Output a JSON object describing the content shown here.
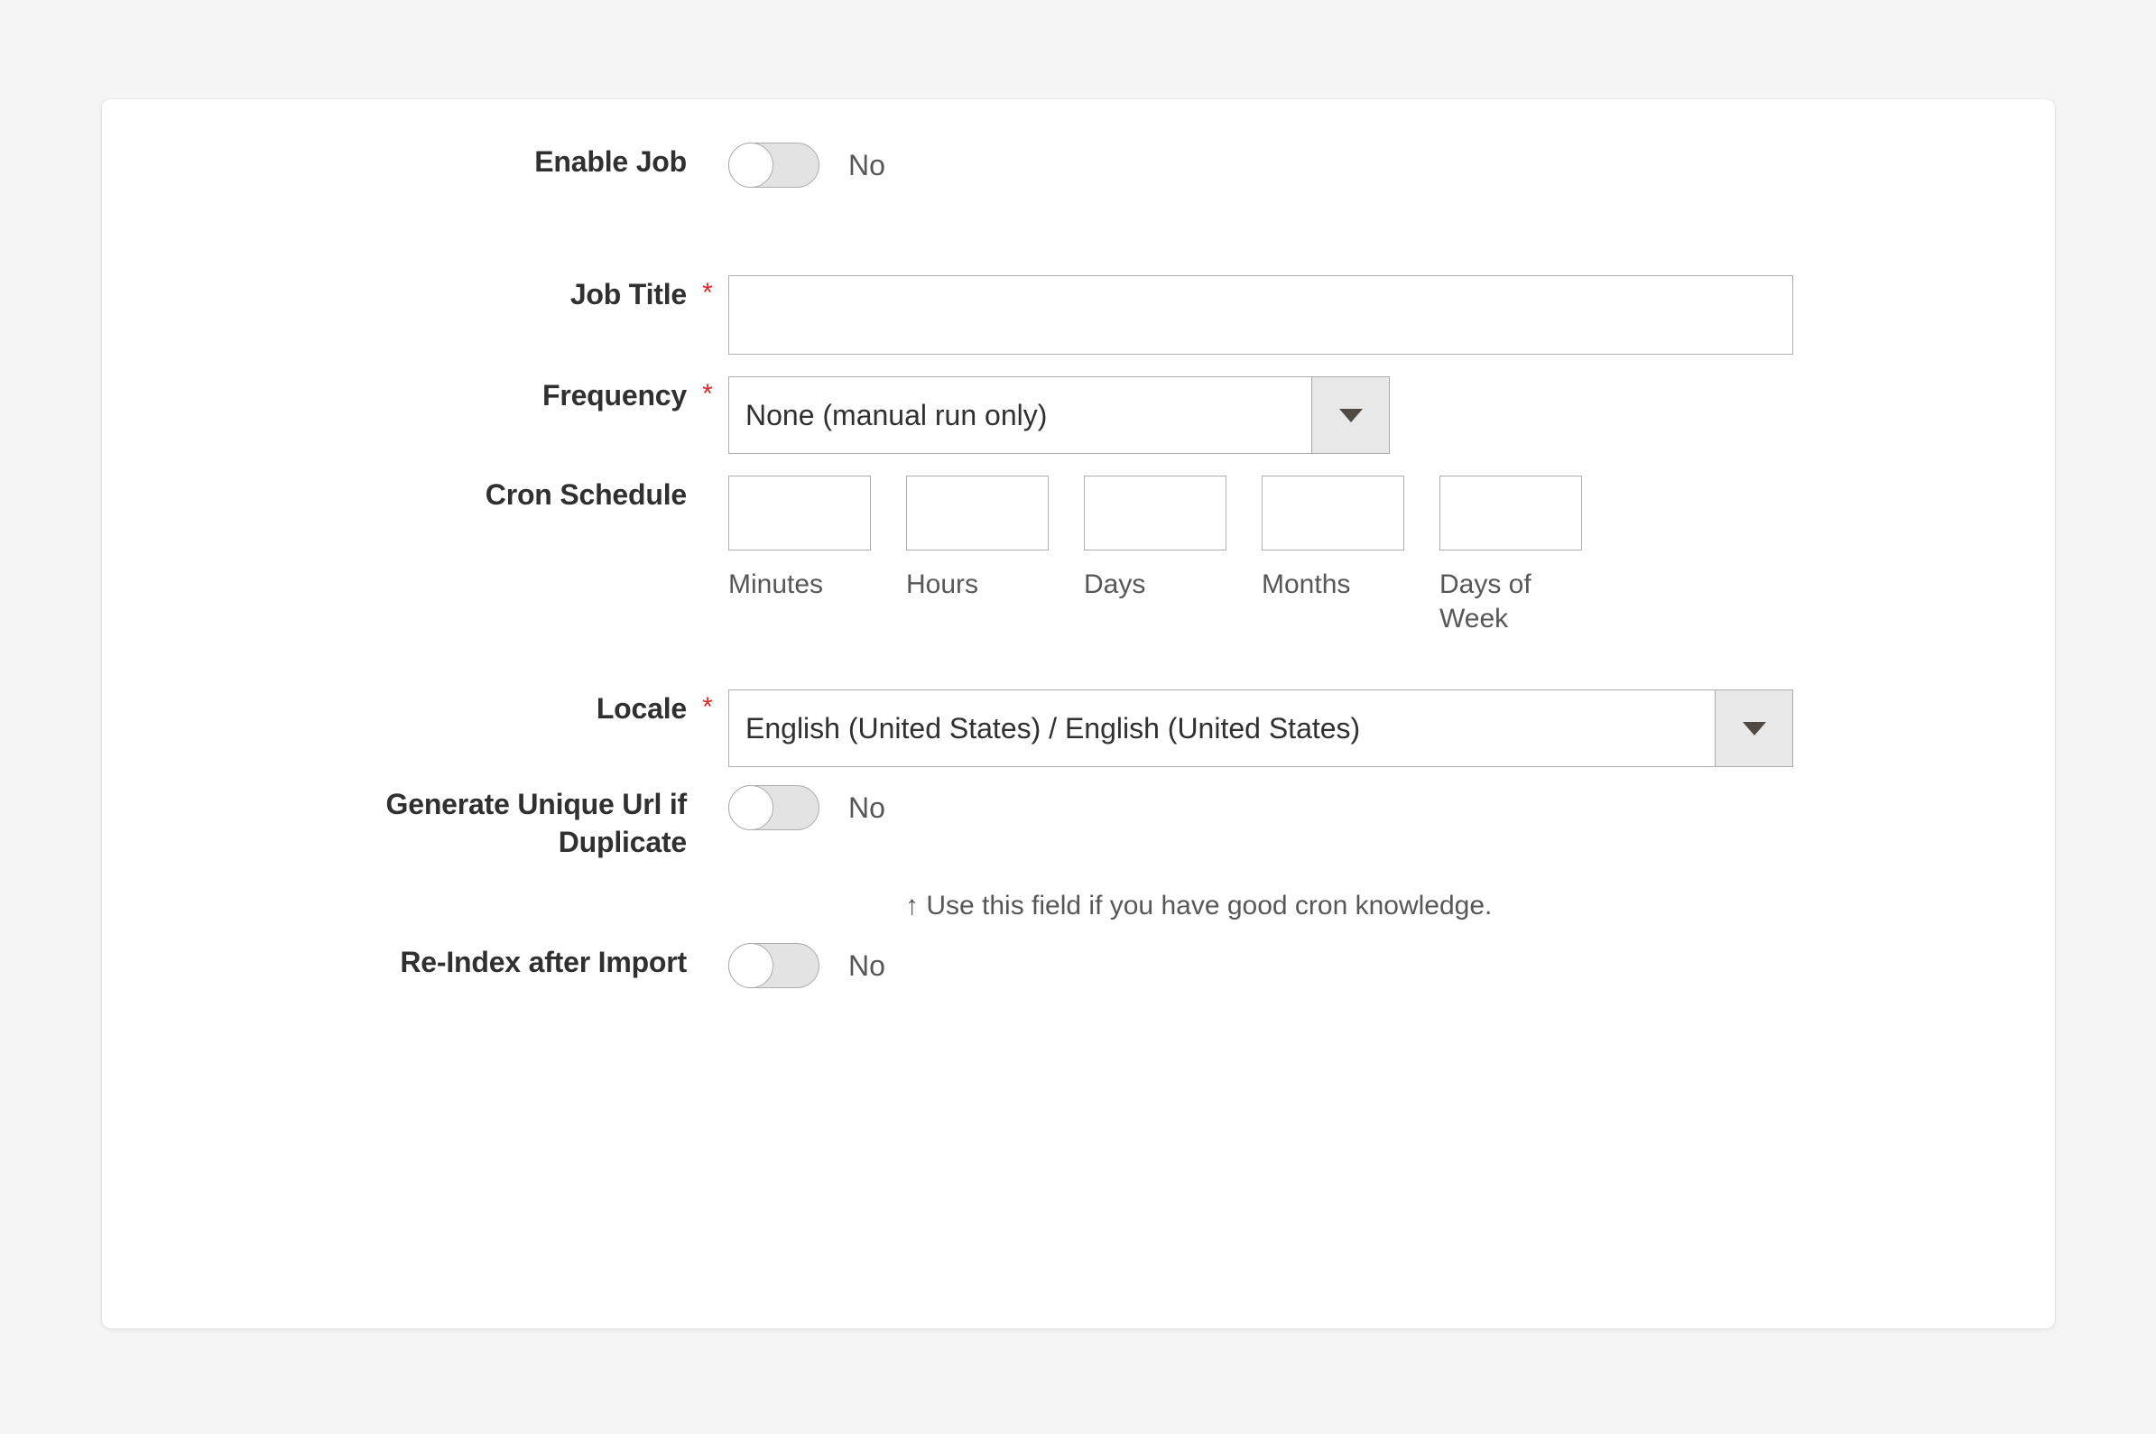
{
  "theme": {
    "page_background": "#f5f5f5",
    "card_background": "#ffffff",
    "label_color": "#303030",
    "value_color": "#575757",
    "required_asterisk_color": "#e02b27",
    "border_color": "#adadad",
    "select_button_background": "#e8e8e8",
    "toggle_track_color": "#e3e3e3",
    "toggle_knob_color": "#ffffff"
  },
  "form": {
    "enable_job": {
      "label": "Enable Job",
      "required": false,
      "toggle_state": "No",
      "toggle_on": false
    },
    "job_title": {
      "label": "Job Title",
      "required": true,
      "required_marker": "*",
      "value": "",
      "placeholder": ""
    },
    "frequency": {
      "label": "Frequency",
      "required": true,
      "required_marker": "*",
      "selected": "None (manual run only)",
      "arrow_icon": "chevron-down-icon"
    },
    "cron_schedule": {
      "label": "Cron Schedule",
      "required": false,
      "fields": [
        {
          "caption": "Minutes",
          "value": ""
        },
        {
          "caption": "Hours",
          "value": ""
        },
        {
          "caption": "Days",
          "value": ""
        },
        {
          "caption": "Months",
          "value": ""
        },
        {
          "caption": "Days of Week",
          "value": ""
        }
      ],
      "note": "↑ Use this field if you have good cron knowledge."
    },
    "locale": {
      "label": "Locale",
      "required": true,
      "required_marker": "*",
      "selected": "English (United States) / English (United States)",
      "arrow_icon": "chevron-down-icon"
    },
    "generate_unique_url": {
      "label": "Generate Unique Url if Duplicate",
      "required": false,
      "toggle_state": "No",
      "toggle_on": false
    },
    "reindex_after_import": {
      "label": "Re-Index after Import",
      "required": false,
      "toggle_state": "No",
      "toggle_on": false
    }
  }
}
